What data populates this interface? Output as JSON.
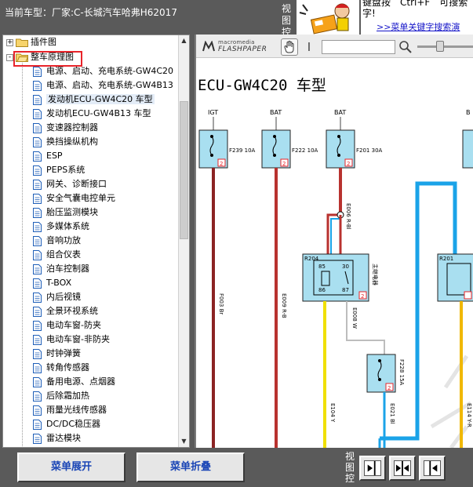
{
  "top": {
    "car_info": "当前车型：厂家:C-长城汽车哈弗H62017",
    "view_control_cut": "视图控",
    "hint_line1": "键盘按　Ctrl+F　可搜索",
    "hint_line2": "字!",
    "menu_search_link": ">>菜单关键字搜索演"
  },
  "tree": {
    "root_items": [
      {
        "label": "插件图",
        "expander": "+"
      },
      {
        "label": "整车原理图",
        "expander": "-"
      }
    ],
    "children": [
      "电源、启动、充电系统-GW4C20",
      "电源、启动、充电系统-GW4B13",
      "发动机ECU-GW4C20 车型",
      "发动机ECU-GW4B13 车型",
      "变速器控制器",
      "换挡操纵机构",
      "ESP",
      "PEPS系统",
      "网关、诊断接口",
      "安全气囊电控单元",
      "胎压监测模块",
      "多媒体系统",
      "音响功放",
      "组合仪表",
      "泊车控制器",
      "T-BOX",
      "内后视镜",
      "全景环视系统",
      "电动车窗-防夹",
      "电动车窗-非防夹",
      "时钟弹簧",
      "转角传感器",
      "备用电源、点烟器",
      "后除霜加热",
      "雨量光线传感器",
      "DC/DC稳压器",
      "雷达模块"
    ],
    "selected_index": 2
  },
  "viewer": {
    "logo_top": "macromedia",
    "logo_bottom": "FLASHPAPER",
    "page_value": "",
    "doc_title": "ECU-GW4C20 车型",
    "diagram_labels": {
      "igt": "IGT",
      "bat1": "BAT",
      "bat2": "BAT",
      "b_cut": "B",
      "f239": "F239 10A",
      "f222": "F222 10A",
      "f201": "F201 30A",
      "f228": "F228 15A",
      "r204": "R204",
      "r201": "R201",
      "relay_name": "主继电器",
      "pin85": "85",
      "pin30": "30",
      "pin86": "86",
      "pin87": "87",
      "wire_f003": "F003 Br",
      "wire_e009a": "E009 R-B",
      "wire_e008": "E008 W",
      "wire_e006": "E006 R-Bl",
      "wire_e104": "E104 Y",
      "wire_e021": "E021 Bl",
      "wire_e114": "E114 Y-R",
      "tag": "2"
    }
  },
  "bottom": {
    "expand_label": "菜单展开",
    "collapse_label": "菜单折叠",
    "view_label": "视图控"
  },
  "colors": {
    "chrome": "#5a5a5a",
    "selection": "#e3ecf7",
    "highlight_box": "#e8242a",
    "button_text": "#1b46b6",
    "fuse_box": "#a9dff0",
    "wire_brown": "#8b2323",
    "wire_red": "#b8322f",
    "wire_yellow": "#f0e000",
    "wire_blue": "#1aa3e8",
    "wire_white": "#bdbdbd"
  }
}
